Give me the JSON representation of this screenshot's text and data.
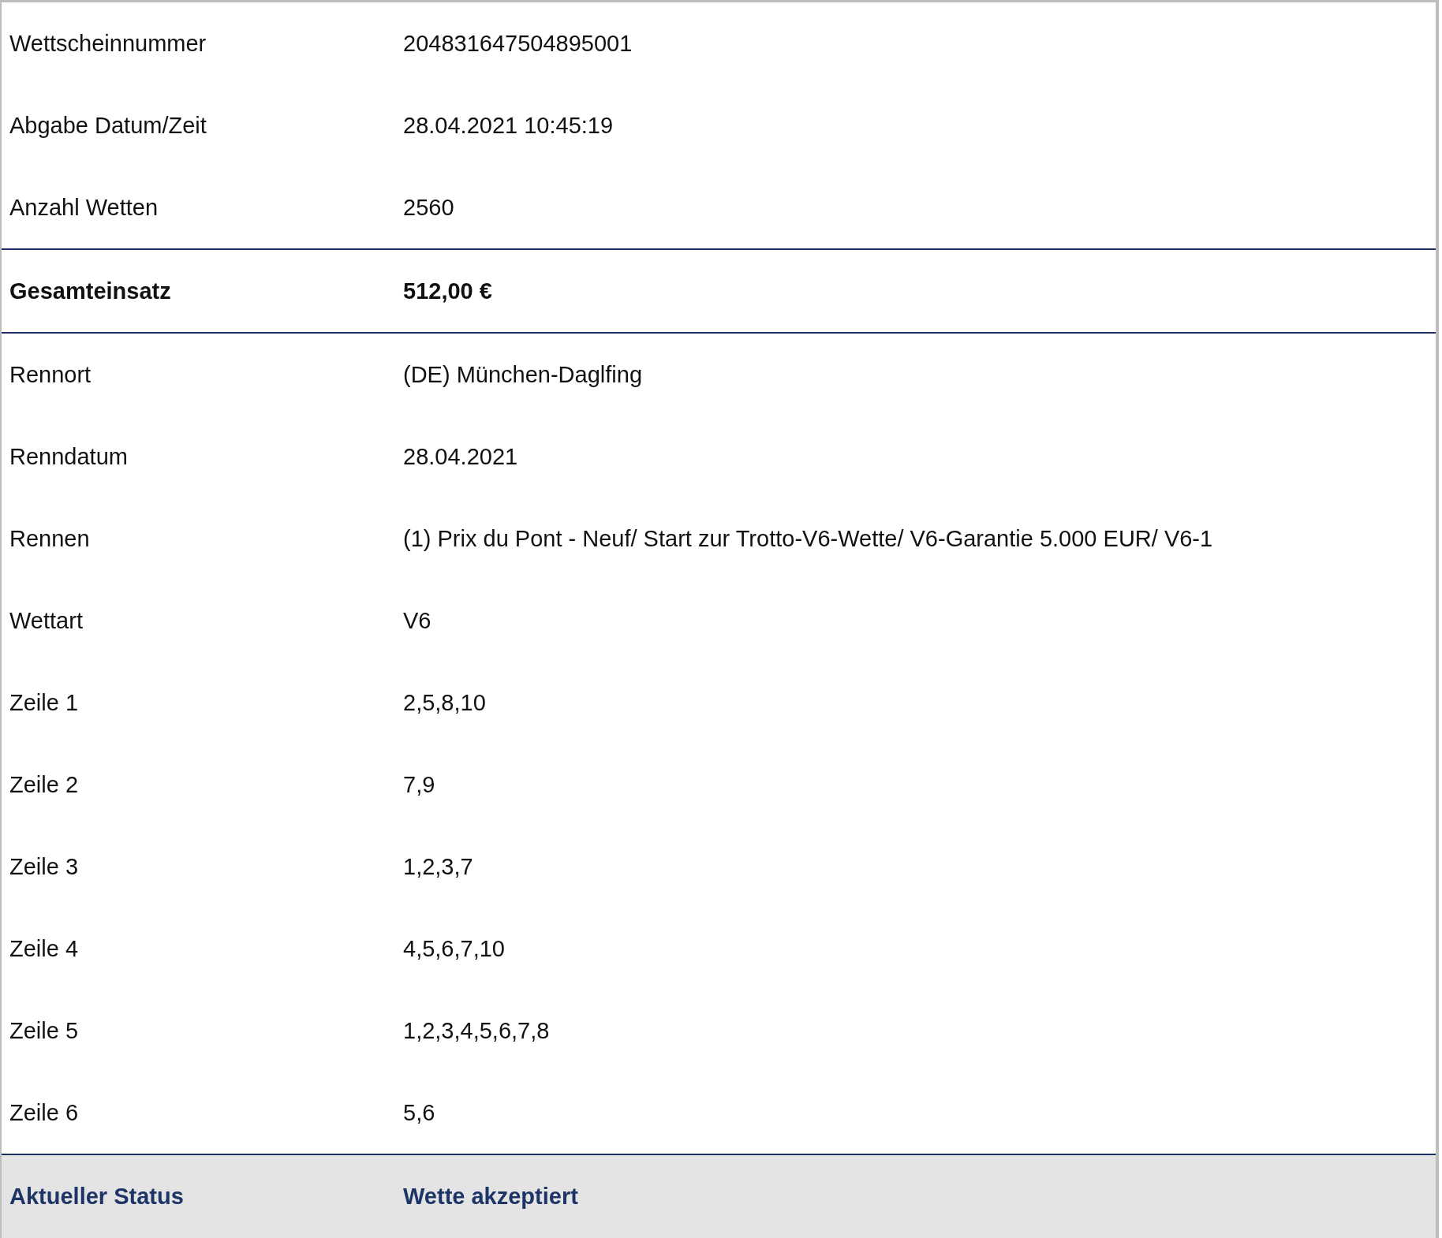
{
  "rows": [
    {
      "kind": "normal",
      "label": "Wettscheinnummer",
      "value": "204831647504895001"
    },
    {
      "kind": "normal",
      "label": "Abgabe Datum/Zeit",
      "value": "28.04.2021 10:45:19"
    },
    {
      "kind": "normal",
      "label": "Anzahl Wetten",
      "value": "2560"
    },
    {
      "kind": "total",
      "label": "Gesamteinsatz",
      "value": "512,00 €"
    },
    {
      "kind": "normal",
      "label": "Rennort",
      "value": "(DE) München-Daglfing"
    },
    {
      "kind": "normal",
      "label": "Renndatum",
      "value": "28.04.2021"
    },
    {
      "kind": "normal",
      "label": "Rennen",
      "value": "(1) Prix du Pont - Neuf/ Start zur Trotto-V6-Wette/ V6-Garantie 5.000 EUR/ V6-1"
    },
    {
      "kind": "normal",
      "label": "Wettart",
      "value": "V6"
    },
    {
      "kind": "normal",
      "label": "Zeile 1",
      "value": "2,5,8,10"
    },
    {
      "kind": "normal",
      "label": "Zeile 2",
      "value": "7,9"
    },
    {
      "kind": "normal",
      "label": "Zeile 3",
      "value": "1,2,3,7"
    },
    {
      "kind": "normal",
      "label": "Zeile 4",
      "value": "4,5,6,7,10"
    },
    {
      "kind": "normal",
      "label": "Zeile 5",
      "value": "1,2,3,4,5,6,7,8"
    },
    {
      "kind": "normal",
      "label": "Zeile 6",
      "value": "5,6"
    },
    {
      "kind": "status",
      "label": "Aktueller Status",
      "value": "Wette akzeptiert"
    }
  ]
}
